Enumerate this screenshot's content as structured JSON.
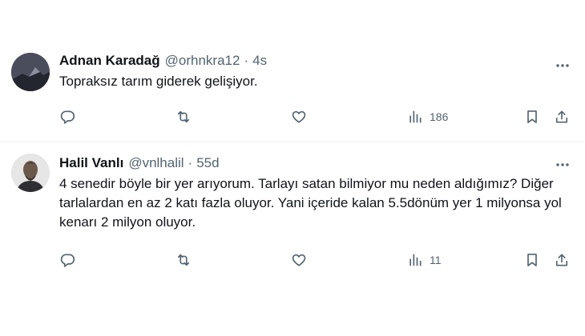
{
  "tweets": [
    {
      "name": "Adnan Karadağ",
      "handle": "@orhnkra12",
      "dot": "·",
      "time": "4s",
      "text": "Topraksız tarım giderek gelişiyor.",
      "views": "186"
    },
    {
      "name": "Halil Vanlı",
      "handle": "@vnlhalil",
      "dot": "·",
      "time": "55d",
      "text": "4 senedir böyle bir yer arıyorum. Tarlayı satan bilmiyor mu neden aldığımız? Diğer tarlalardan en az 2 katı fazla oluyor. Yani içeride kalan 5.5dönüm yer 1 milyonsa yol kenarı 2 milyon oluyor.",
      "views": "11"
    }
  ],
  "icons": {
    "reply": "reply-icon",
    "retweet": "retweet-icon",
    "like": "heart-icon",
    "views": "views-icon",
    "bookmark": "bookmark-icon",
    "share": "share-icon",
    "more": "more-icon"
  },
  "colors": {
    "text": "#0f1419",
    "secondary": "#536471",
    "divider": "#eff3f4"
  }
}
